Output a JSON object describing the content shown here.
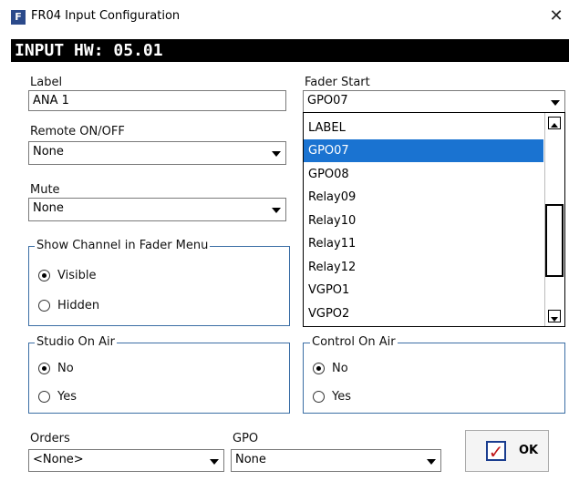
{
  "window": {
    "title": "FR04 Input Configuration",
    "icon_letter": "F",
    "close": "✕"
  },
  "header": {
    "title": "INPUT HW: 05.01"
  },
  "label": {
    "caption": "Label",
    "value": "ANA 1"
  },
  "remote": {
    "caption": "Remote ON/OFF",
    "value": "None"
  },
  "mute": {
    "caption": "Mute",
    "value": "None"
  },
  "show_channel": {
    "title": "Show Channel in Fader Menu",
    "options": [
      {
        "label": "Visible",
        "selected": true
      },
      {
        "label": "Hidden",
        "selected": false
      }
    ]
  },
  "studio_on_air": {
    "title": "Studio On Air",
    "options": [
      {
        "label": "No",
        "selected": true
      },
      {
        "label": "Yes",
        "selected": false
      }
    ]
  },
  "control_on_air": {
    "title": "Control On Air",
    "options": [
      {
        "label": "No",
        "selected": true
      },
      {
        "label": "Yes",
        "selected": false
      }
    ]
  },
  "fader_start": {
    "caption": "Fader Start",
    "value": "GPO07",
    "list": [
      "LABEL",
      "GPO07",
      "GPO08",
      "Relay09",
      "Relay10",
      "Relay11",
      "Relay12",
      "VGPO1",
      "VGPO2"
    ],
    "selected_index": 1
  },
  "orders": {
    "caption": "Orders",
    "value": "<None>"
  },
  "gpo": {
    "caption": "GPO",
    "value": "None"
  },
  "ok_button": {
    "label": "OK",
    "icon": "checkbox-check-icon"
  },
  "colors": {
    "accent": "#1a73d1",
    "group_border": "#3b6ea5",
    "header_bg": "#000000"
  }
}
